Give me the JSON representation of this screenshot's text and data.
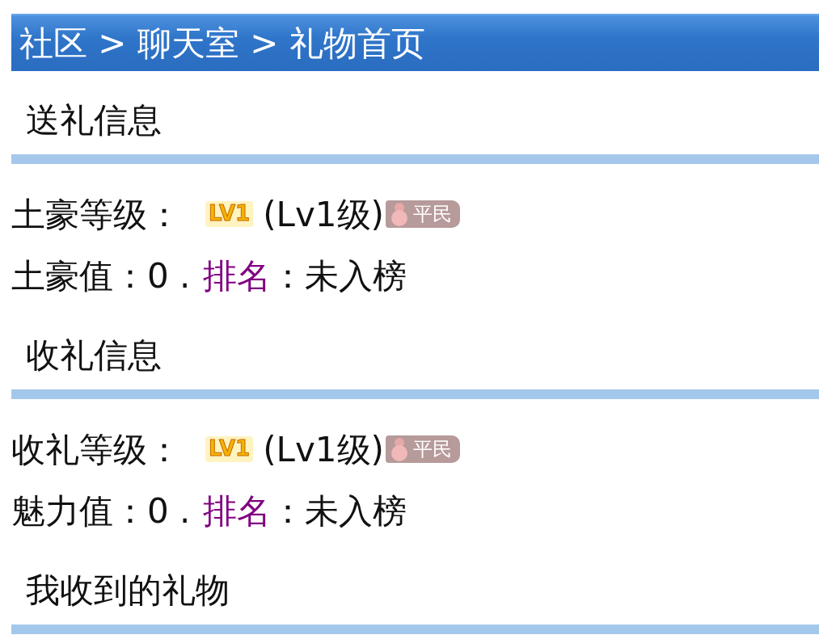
{
  "breadcrumb": "社区 > 聊天室 > 礼物首页",
  "sections": [
    {
      "title": "送礼信息",
      "lines": [
        {
          "kind": "level",
          "label": "土豪等级：",
          "badge": "LV1",
          "level_text": "(Lv1级)",
          "rank_badge": "平民"
        },
        {
          "kind": "value",
          "label": "土豪值：",
          "value": "0 .",
          "rank_link": "排名",
          "rank_text": "：未入榜"
        }
      ]
    },
    {
      "title": "收礼信息",
      "lines": [
        {
          "kind": "level",
          "label": "收礼等级：",
          "badge": "LV1",
          "level_text": "(Lv1级)",
          "rank_badge": "平民"
        },
        {
          "kind": "value",
          "label": "魅力值：",
          "value": "0 .",
          "rank_link": "排名",
          "rank_text": "：未入榜"
        }
      ]
    },
    {
      "title": "我收到的礼物"
    }
  ]
}
